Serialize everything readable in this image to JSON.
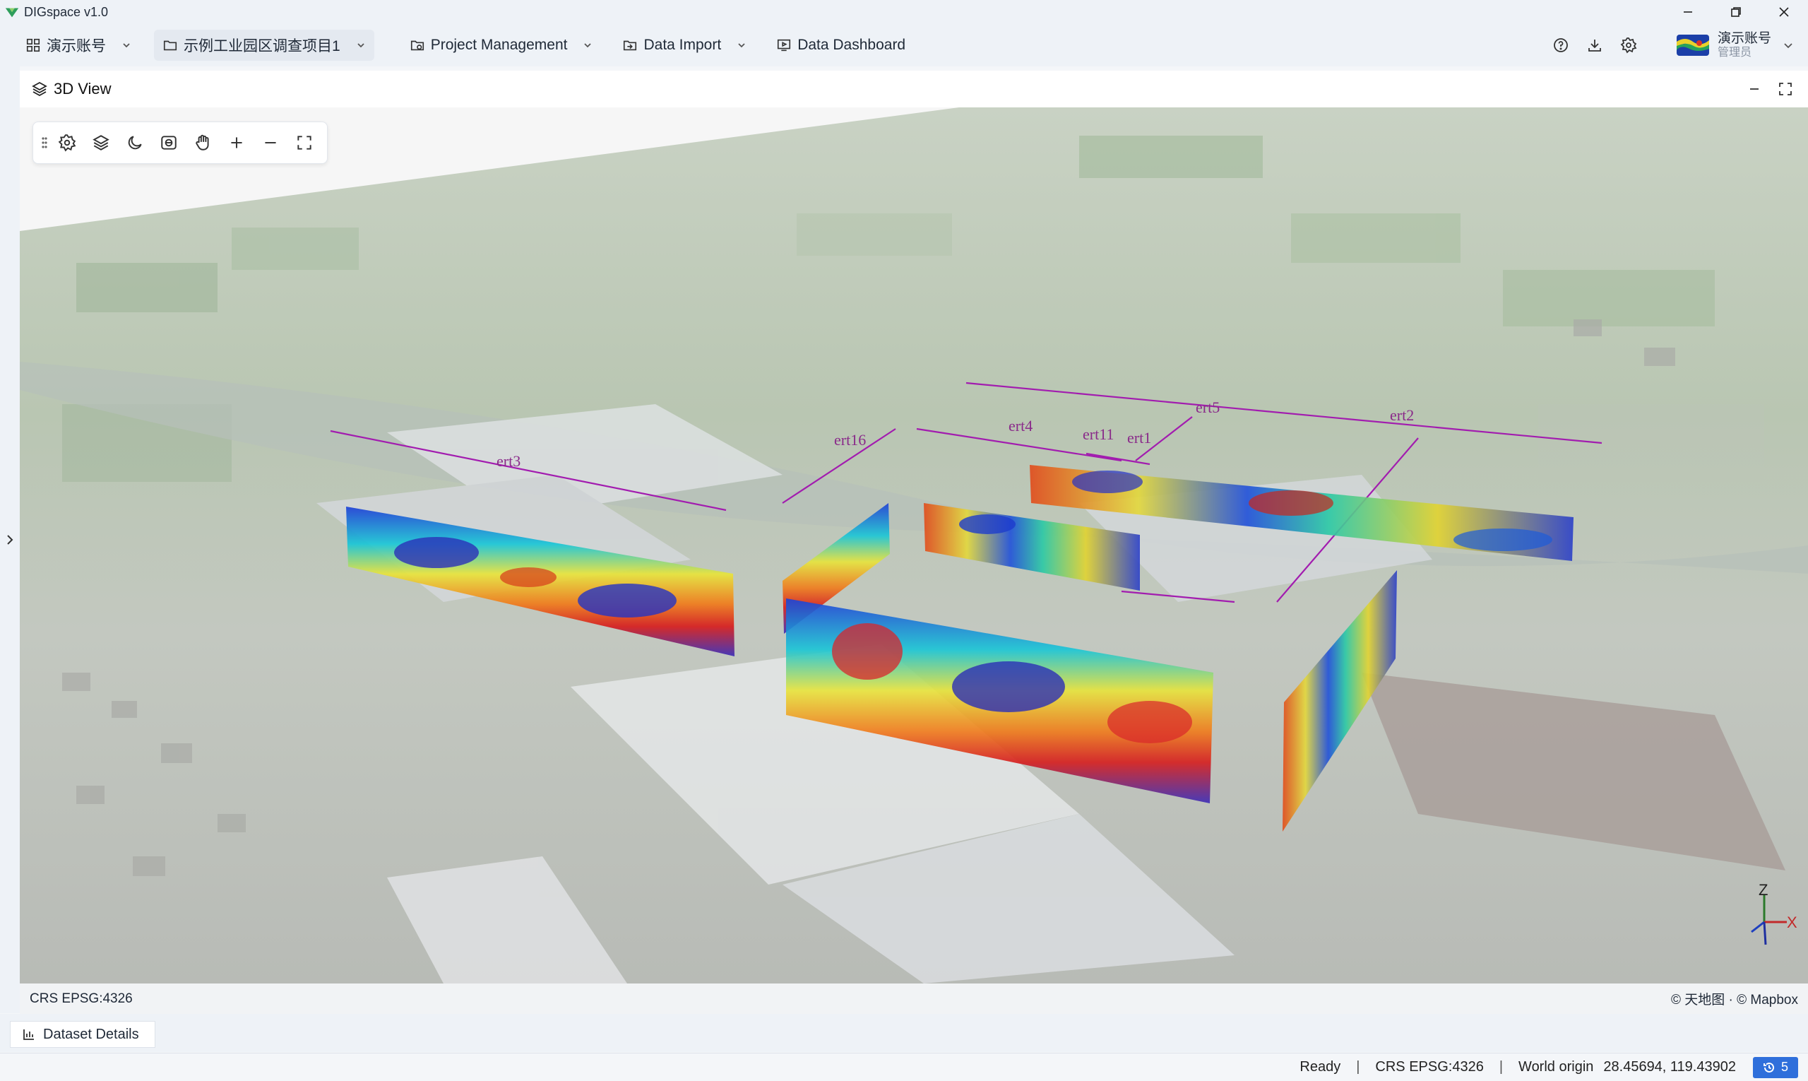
{
  "window": {
    "title": "DIGspace v1.0",
    "icon": "app-logo-icon"
  },
  "menubar": {
    "account_label": "演示账号",
    "project_label": "示例工业园区调查项目1",
    "project_management_label": "Project Management",
    "data_import_label": "Data Import",
    "data_dashboard_label": "Data Dashboard",
    "right_icons": [
      "help-icon",
      "download-icon",
      "settings-icon"
    ],
    "user": {
      "name": "演示账号",
      "role": "管理员"
    }
  },
  "panel": {
    "title": "3D View",
    "map_tools": [
      "drag-grip-icon",
      "settings-icon",
      "layers-icon",
      "moon-icon",
      "camera-icon",
      "pan-hand-icon",
      "zoom-in-icon",
      "zoom-out-icon",
      "fullscreen-icon"
    ]
  },
  "scene": {
    "profile_labels": [
      "ert3",
      "ert16",
      "ert4",
      "ert11",
      "ert1",
      "ert5",
      "ert2"
    ],
    "colors": {
      "survey_line": "#a21caf",
      "label": "#8a2a8a"
    },
    "axes_labels": {
      "z": "Z",
      "x": "X"
    }
  },
  "attribution": {
    "crs": "CRS EPSG:4326",
    "copyright": "© 天地图 · © Mapbox"
  },
  "details_tab": {
    "label": "Dataset Details"
  },
  "statusbar": {
    "status": "Ready",
    "crs": "CRS EPSG:4326",
    "world_origin_label": "World origin",
    "world_origin_value": "28.45694, 119.43902",
    "history_count": "5"
  }
}
